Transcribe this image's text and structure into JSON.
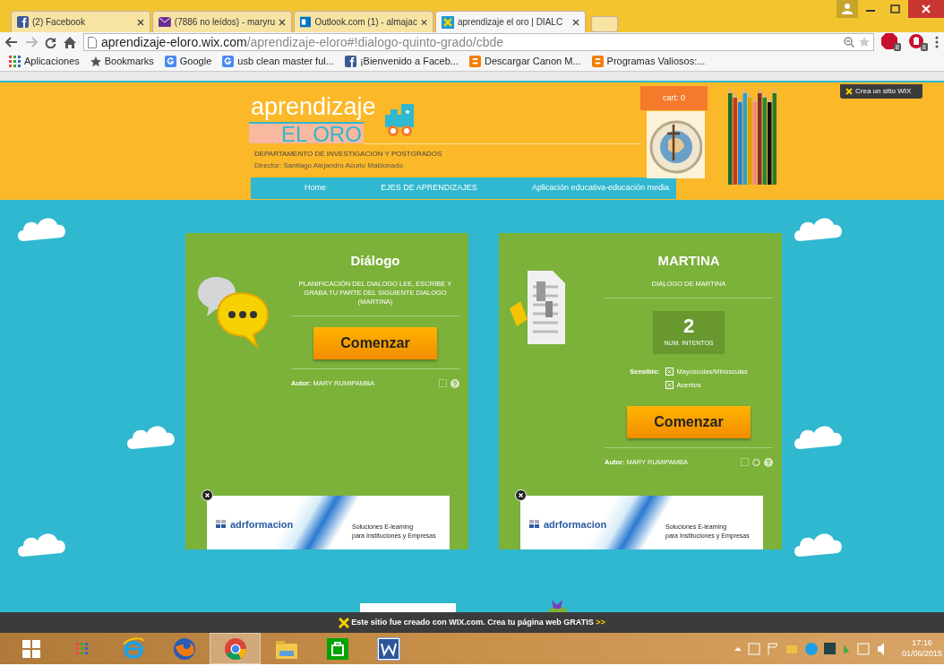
{
  "browser": {
    "tabs": [
      {
        "title": "(2) Facebook",
        "selected": false
      },
      {
        "title": "(7886 no leídos) - maryru",
        "selected": false
      },
      {
        "title": "Outlook.com (1) - almajac",
        "selected": false
      },
      {
        "title": "aprendizaje el oro | DIALC",
        "selected": true
      }
    ],
    "address": {
      "host": "aprendizaje-eloro.wix.com",
      "path": "/aprendizaje-eloro#!dialogo-quinto-grado/cbde"
    },
    "extension_badges": [
      "8",
      "8"
    ],
    "bookmarks": [
      {
        "label": "Aplicaciones"
      },
      {
        "label": "Bookmarks"
      },
      {
        "label": "Google"
      },
      {
        "label": "usb clean master ful..."
      },
      {
        "label": "¡Bienvenido a Faceb..."
      },
      {
        "label": "Descargar Canon M..."
      },
      {
        "label": "Programas Valiosos:..."
      }
    ]
  },
  "site": {
    "logo_top": "aprendizaje",
    "logo_bottom": "EL ORO",
    "department": "DEPARTAMENTO DE INVESTIGACION Y POSTGRADOS",
    "director": "Director: Santiago Alejandro Acurio Maldonado",
    "cart": "cart: 0",
    "wix_badge": "Crea un sitio WIX",
    "nav": [
      {
        "label": "Home"
      },
      {
        "label": "EJES DE APRENDIZAJES"
      },
      {
        "label": "Aplicación educativa-educación media"
      }
    ]
  },
  "cards": [
    {
      "kind": "dialog",
      "title": "Diálogo",
      "description": "PLANIFICACIÓN DEL DIALOGO LEE, ESCRIBE Y GRABA TU PARTE DEL SIGUIENTE DIALOGO (MARTINA)",
      "button": "Comenzar",
      "author_label": "Autor:",
      "author": "MARY RUMIPAMBA",
      "ad": {
        "brand": "adrformacion",
        "tagline": [
          "Soluciones E-learning",
          "para Instituciones y Empresas"
        ]
      }
    },
    {
      "kind": "quiz",
      "title": "MARTINA",
      "description": "DIALOGO DE MARTINA",
      "attempts": "2",
      "attempts_label": "NUM. INTENTOS",
      "sensible_label": "Sensible:",
      "options": [
        {
          "label": "Mayúsculas/Minúsculas",
          "checked": true
        },
        {
          "label": "Acentos",
          "checked": true
        }
      ],
      "button": "Comenzar",
      "author_label": "Autor:",
      "author": "MARY RUMIPAMBA",
      "ad": {
        "brand": "adrformacion",
        "tagline": [
          "Soluciones E-learning",
          "para Instituciones y Empresas"
        ]
      }
    }
  ],
  "wix_footer": {
    "text": "Este sitio fue creado con WIX.com. Crea tu página web GRATIS",
    "arrows": ">>"
  },
  "taskbar": {
    "apps": [
      {
        "selected": false
      },
      {
        "selected": false
      },
      {
        "selected": false
      },
      {
        "selected": false
      },
      {
        "selected": true
      },
      {
        "selected": false
      },
      {
        "selected": false
      },
      {
        "selected": false
      }
    ],
    "time": "17:16",
    "date": "01/06/2015"
  }
}
